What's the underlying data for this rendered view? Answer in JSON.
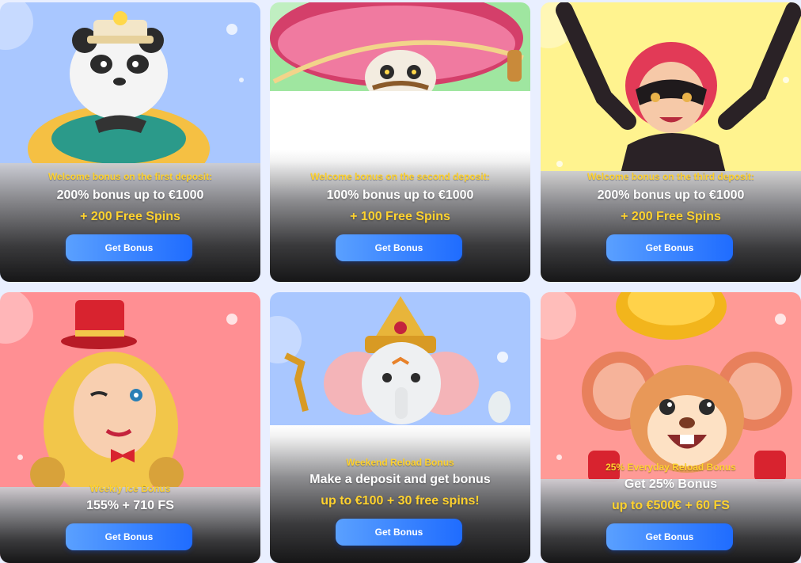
{
  "colors": {
    "page_bg": "#e9efff",
    "accent_yellow": "#ffd22e",
    "button_blue_start": "#5aa0ff",
    "button_blue_end": "#1f6cff"
  },
  "cards": [
    {
      "art": "panda-character-illustration",
      "bg": "#a9c7ff",
      "label": "Welcome bonus on the first deposit:",
      "line1": "200% bonus up to €1000",
      "line2": "+ 200 Free Spins",
      "button": "Get Bonus"
    },
    {
      "art": "sombrero-skeleton-illustration",
      "bg": "#9fe6a0",
      "label": "Welcome bonus on the second deposit:",
      "line1": "100% bonus up to €1000",
      "line2": "+ 100 Free Spins",
      "button": "Get Bonus"
    },
    {
      "art": "masked-heroine-illustration",
      "bg": "#fff38f",
      "label": "Welcome bonus on the third deposit:",
      "line1": "200% bonus up to €1000",
      "line2": "+ 200 Free Spins",
      "button": "Get Bonus"
    },
    {
      "art": "ringmaster-girl-illustration",
      "bg": "#ff8f93",
      "label": "Weekly Ice Bonus",
      "line1": "155% + 710 FS",
      "line2": "",
      "button": "Get Bonus"
    },
    {
      "art": "ganesha-elephant-illustration",
      "bg": "#a9c7ff",
      "label": "Weekend Reload Bonus",
      "line1": "Make a deposit and get bonus",
      "line2": "up to €100 + 30 free spins!",
      "button": "Get Bonus"
    },
    {
      "art": "mouse-with-coin-illustration",
      "bg": "#ff9a96",
      "label": "25% Everyday Reload Bonus",
      "line1": "Get 25% Bonus",
      "line2": "up to €500€ + 60 FS",
      "button": "Get Bonus"
    }
  ]
}
